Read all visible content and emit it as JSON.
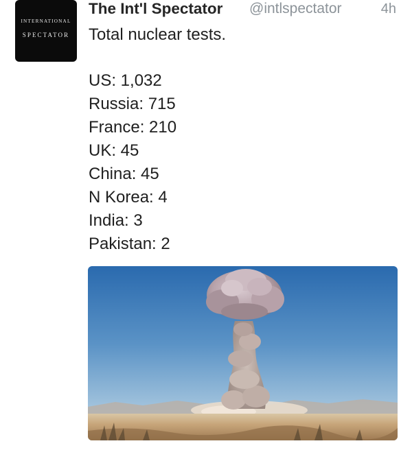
{
  "tweet": {
    "avatar": {
      "line1": "INTERNATIONAL",
      "line2": "SPECTATOR"
    },
    "display_name": "The Int'l Spectator",
    "handle": "@intlspectator",
    "timestamp": "4h",
    "intro": "Total nuclear tests.",
    "lines": [
      "US: 1,032",
      "Russia: 715",
      "France: 210",
      "UK: 45",
      "China: 45",
      "N Korea: 4",
      "India: 3",
      "Pakistan: 2"
    ],
    "photo_icon": "mushroom-cloud-photo"
  },
  "colors": {
    "name": "#262626",
    "muted": "#8c9399",
    "avatar_bg": "#0b0b0b",
    "sky_top": "#2d6fb3",
    "sky_bottom": "#b9d3e6",
    "ground": "#c9a87a"
  }
}
